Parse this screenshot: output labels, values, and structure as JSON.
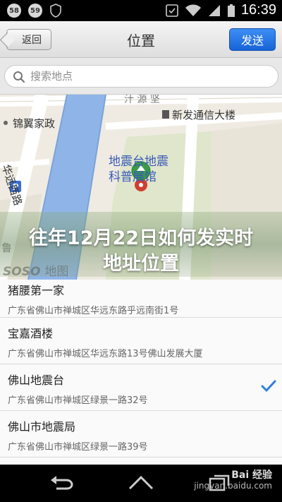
{
  "status_bar": {
    "badges": [
      "58",
      "59"
    ],
    "time": "16:39"
  },
  "header": {
    "back_label": "返回",
    "title": "位置",
    "send_label": "发送"
  },
  "search": {
    "placeholder": "搜索地点"
  },
  "map": {
    "labels": {
      "jinyi": "锦翼家政",
      "xinfa": "新发通信大楼",
      "huayuan": "华远西路",
      "poi_line1": "地震台地震",
      "poi_line2": "科普展馆",
      "side_text": "鲁",
      "upper_text": "汁 源 坚"
    },
    "brand": "SOSO",
    "brand_suffix": "地图",
    "colors": {
      "river": "#8fb5e8",
      "park": "#c8dcb0",
      "pin": "#3a9a4a"
    }
  },
  "overlay": {
    "title": "往年12月22日如何发实时地址位置"
  },
  "places": [
    {
      "name": "猪腰第一家",
      "address": "广东省佛山市禅城区华远东路乎远南街1号",
      "selected": false
    },
    {
      "name": "宝嘉酒楼",
      "address": "广东省佛山市禅城区华远东路13号佛山发展大厦",
      "selected": false
    },
    {
      "name": "佛山地震台",
      "address": "广东省佛山市禅城区绿景一路32号",
      "selected": true
    },
    {
      "name": "佛山市地震局",
      "address": "广东省佛山市禅城区绿景一路39号",
      "selected": false
    }
  ],
  "watermark": {
    "brand": "Bai 经验",
    "url": "jingyan.baidu.com"
  }
}
